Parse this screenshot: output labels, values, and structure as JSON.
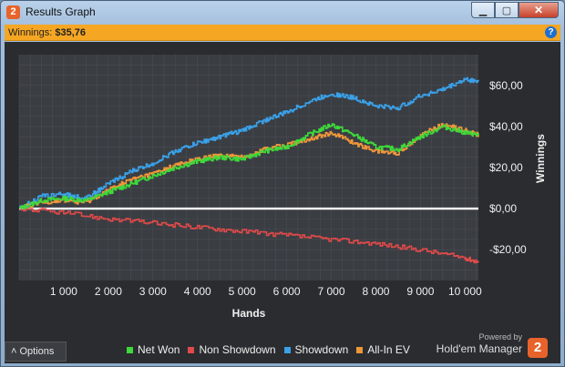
{
  "window": {
    "title": "Results Graph"
  },
  "winnings_bar": {
    "label": "Winnings:",
    "value": "$35,76"
  },
  "footer": {
    "options_label": "Options",
    "powered_by": "Powered by",
    "brand": "Hold'em Manager",
    "brand_logo": "2"
  },
  "colors": {
    "net_won": "#3ed93a",
    "non_showdown": "#e04a4a",
    "showdown": "#3aa0e8",
    "all_in_ev": "#f0963a"
  },
  "chart_data": {
    "type": "line",
    "xlabel": "Hands",
    "ylabel": "Winnings",
    "xlim": [
      0,
      10300
    ],
    "ylim": [
      -35,
      75
    ],
    "x_ticks": [
      1000,
      2000,
      3000,
      4000,
      5000,
      6000,
      7000,
      8000,
      9000,
      10000
    ],
    "x_tick_labels": [
      "1 000",
      "2 000",
      "3 000",
      "4 000",
      "5 000",
      "6 000",
      "7 000",
      "8 000",
      "9 000",
      "10 000"
    ],
    "y_ticks": [
      -20,
      0,
      20,
      40,
      60
    ],
    "y_tick_labels": [
      "-$20,00",
      "$0,00",
      "$20,00",
      "$40,00",
      "$60,00"
    ],
    "grid": true,
    "legend": "bottom",
    "series": [
      {
        "name": "Net Won",
        "x": [
          0,
          500,
          1000,
          1500,
          2000,
          2500,
          3000,
          3500,
          4000,
          4500,
          5000,
          5500,
          6000,
          6500,
          7000,
          7500,
          8000,
          8500,
          9000,
          9500,
          10000,
          10300
        ],
        "y": [
          0,
          4,
          5,
          4,
          8,
          12,
          16,
          20,
          23,
          25,
          24,
          28,
          30,
          36,
          41,
          36,
          30,
          29,
          35,
          40,
          37,
          36
        ]
      },
      {
        "name": "Non Showdown",
        "x": [
          0,
          1000,
          2000,
          3000,
          4000,
          5000,
          6000,
          7000,
          8000,
          9000,
          10000,
          10300
        ],
        "y": [
          0,
          -2,
          -5,
          -7,
          -9,
          -11,
          -13,
          -15,
          -17,
          -20,
          -24,
          -26
        ]
      },
      {
        "name": "Showdown",
        "x": [
          0,
          500,
          1000,
          1500,
          2000,
          2500,
          3000,
          3500,
          4000,
          4500,
          5000,
          5500,
          6000,
          6500,
          7000,
          7500,
          8000,
          8500,
          9000,
          9500,
          10000,
          10300
        ],
        "y": [
          0,
          6,
          7,
          5,
          12,
          18,
          22,
          28,
          32,
          35,
          38,
          43,
          47,
          52,
          56,
          54,
          50,
          49,
          55,
          58,
          63,
          62
        ]
      },
      {
        "name": "All-In EV",
        "x": [
          0,
          500,
          1000,
          1500,
          2000,
          2500,
          3000,
          3500,
          4000,
          4500,
          5000,
          5500,
          6000,
          6500,
          7000,
          7500,
          8000,
          8500,
          9000,
          9500,
          10000,
          10300
        ],
        "y": [
          0,
          3,
          4,
          3,
          9,
          14,
          17,
          21,
          24,
          26,
          25,
          29,
          31,
          34,
          37,
          32,
          28,
          27,
          36,
          41,
          38,
          36
        ]
      }
    ]
  }
}
